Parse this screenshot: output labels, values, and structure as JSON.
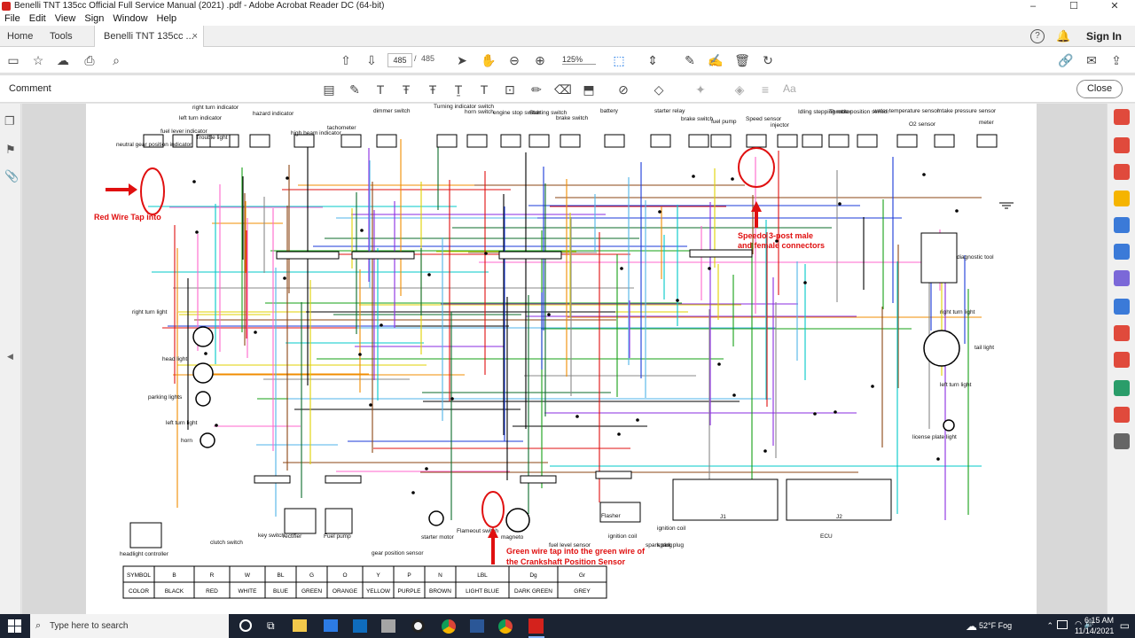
{
  "window": {
    "title": "Benelli TNT 135cc Official Full Service Manual (2021) .pdf - Adobe Acrobat Reader DC (64-bit)",
    "controls": [
      "–",
      "☐",
      "✕"
    ]
  },
  "menu": [
    "File",
    "Edit",
    "View",
    "Sign",
    "Window",
    "Help"
  ],
  "tabs": {
    "home": "Home",
    "tools": "Tools",
    "doc": "Benelli TNT 135cc ...",
    "close": "×"
  },
  "account": {
    "signin": "Sign In"
  },
  "toolbar": {
    "page_current": "485",
    "page_sep": "/",
    "page_total": "485",
    "zoom": "125%"
  },
  "comment": {
    "label": "Comment",
    "close": "Close",
    "aa": "Aa"
  },
  "diagram": {
    "top_labels": [
      "neutral gear position indicator",
      "fuel lever indicator",
      "left turn indicator",
      "right turn indicator",
      "Trouble light",
      "hazard indicator",
      "high beam indicator",
      "tachometer",
      "dimmer switch",
      "Turning indicator switch",
      "horn switch",
      "engine stop switch",
      "Starting switch",
      "brake switch",
      "battery",
      "starter relay",
      "brake switch",
      "fuel pump",
      "Speed sensor",
      "injector",
      "Idling stepping motor",
      "Throttle position sensor",
      "water temperature sensor",
      "O2 sensor",
      "Intake pressure sensor",
      "meter"
    ],
    "side_labels": [
      "right turn light",
      "head light",
      "parking lights",
      "left turn light",
      "horn",
      "headlight controller",
      "clutch switch",
      "key switch",
      "rectifier",
      "Fuel pump",
      "starter motor",
      "Flameout switch",
      "magneto",
      "gear position sensor",
      "fuel level sensor",
      "ignition coil",
      "spark plug",
      "Flasher",
      "ignition coil",
      "spark plug",
      "ECU",
      "J1",
      "J2",
      "diagnostic tool",
      "right turn light",
      "tail light",
      "left turn light",
      "license plate light"
    ],
    "annotations": {
      "red_tap": "Red Wire Tap into",
      "speedo_1": "Speedo 3-post male",
      "speedo_2": "and female connectors",
      "green_1": "Green wire tap into the green wire of",
      "green_2": "the Crankshaft Position Sensor"
    },
    "legend": {
      "symbols": [
        "SYMBOL",
        "B",
        "R",
        "W",
        "BL",
        "G",
        "O",
        "Y",
        "P",
        "N",
        "LBL",
        "Dg",
        "Gr"
      ],
      "colors": [
        "COLOR",
        "BLACK",
        "RED",
        "WHITE",
        "BLUE",
        "GREEN",
        "ORANGE",
        "YELLOW",
        "PURPLE",
        "BROWN",
        "LIGHT BLUE",
        "DARK GREEN",
        "GREY"
      ]
    },
    "wire_colors": [
      "#000000",
      "#e01010",
      "#1a3ad8",
      "#16a016",
      "#f08c00",
      "#e0d000",
      "#8a2be2",
      "#8b4513",
      "#4fb3e8",
      "#0b6b2a",
      "#888888",
      "#ff66cc",
      "#00c8c8"
    ]
  },
  "taskbar": {
    "search": "Type here to search",
    "weather": "52°F Fog",
    "time": "6:15 AM",
    "date": "11/14/2021"
  }
}
